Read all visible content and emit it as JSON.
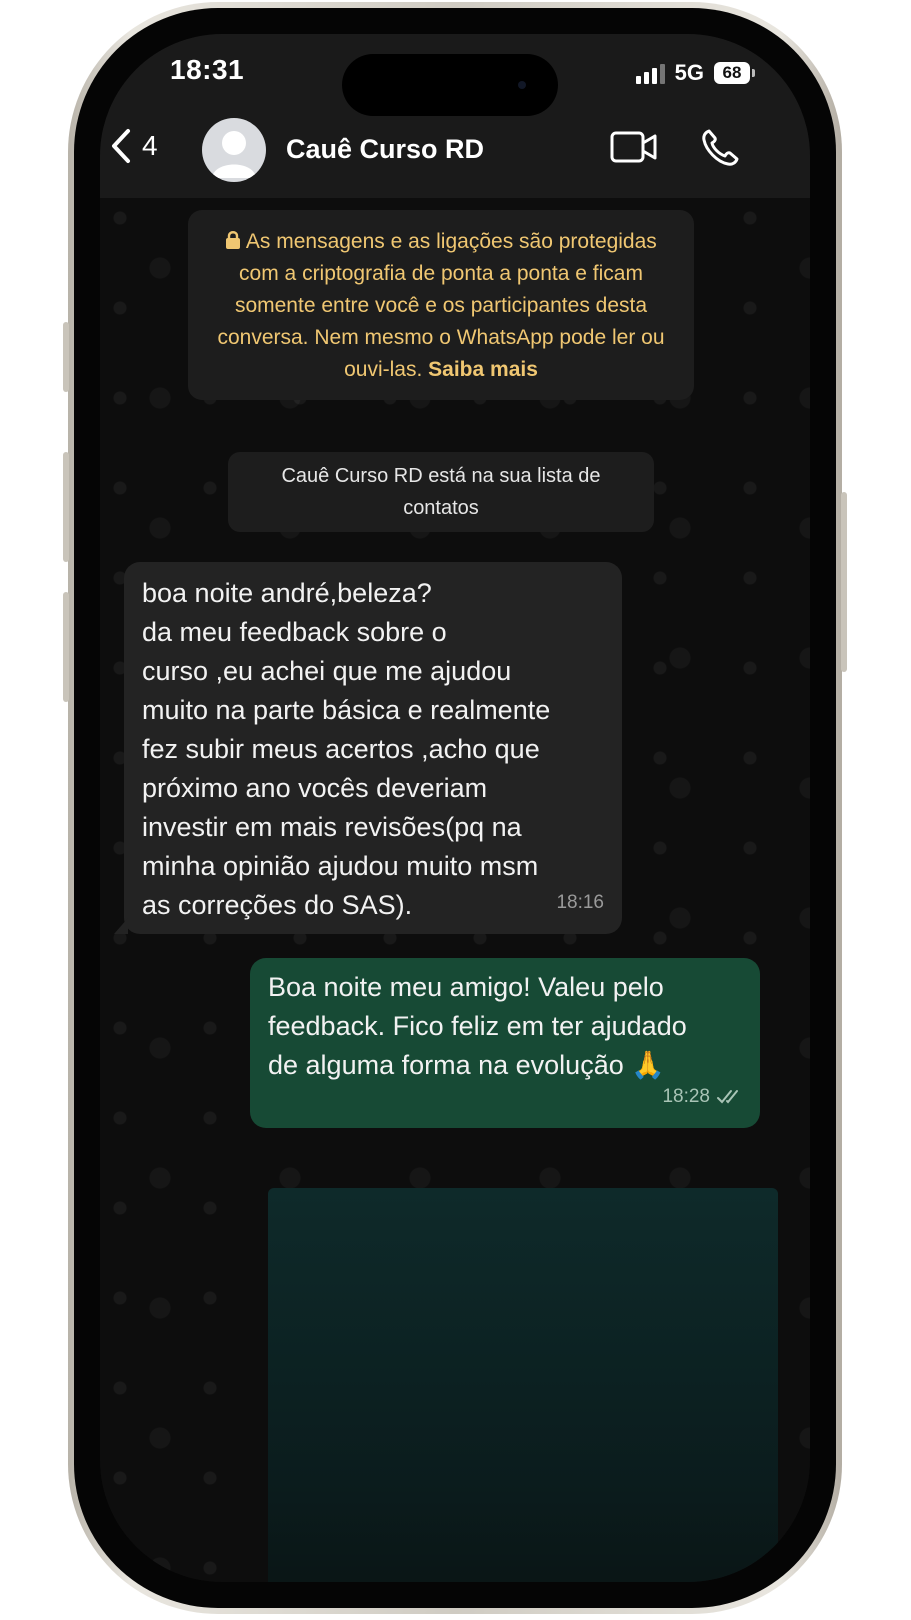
{
  "status_bar": {
    "time": "18:31",
    "network": "5G",
    "battery": "68"
  },
  "header": {
    "back_count": "4",
    "contact_name": "Cauê Curso RD"
  },
  "chat": {
    "encryption_notice": "As mensagens e as ligações são protegidas com a criptografia de ponta a ponta e ficam somente entre você e os participantes desta conversa. Nem mesmo o WhatsApp pode ler ou ouvi-las.",
    "encryption_link": "Saiba mais",
    "contact_notice": "Cauê Curso RD está na sua lista de contatos",
    "messages": [
      {
        "direction": "incoming",
        "text": "boa noite andré,beleza?\nda meu feedback sobre o\ncurso ,eu achei que me ajudou\nmuito na parte básica e realmente\nfez subir meus acertos ,acho que\npróximo ano vocês deveriam\ninvestir em mais revisões(pq na\nminha opinião ajudou muito msm\nas correções do SAS).",
        "time": "18:16"
      },
      {
        "direction": "outgoing",
        "text": "Boa noite meu amigo! Valeu pelo\nfeedback. Fico feliz em ter ajudado\nde alguma forma na evolução 🙏",
        "time": "18:28",
        "read": true
      }
    ]
  },
  "colors": {
    "header_bg": "#1a1a1a",
    "incoming_bubble": "#232323",
    "outgoing_bubble": "#174a35",
    "notice_text": "#f0c772"
  }
}
